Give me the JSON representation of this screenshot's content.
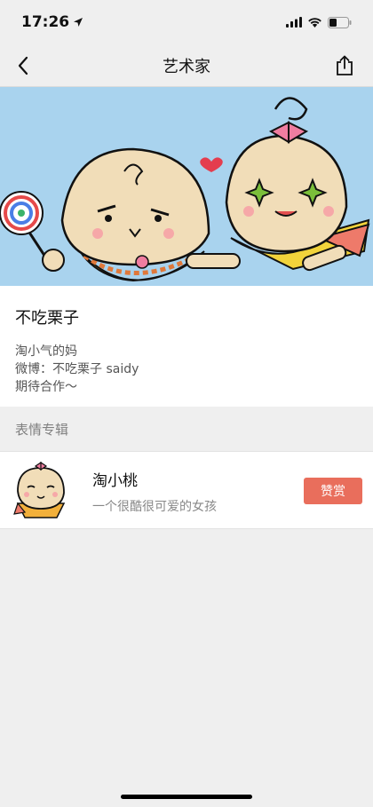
{
  "status_bar": {
    "time": "17:26"
  },
  "nav": {
    "title": "艺术家"
  },
  "profile": {
    "name": "不吃栗子",
    "bio": [
      "淘小气的妈",
      "微博：不吃栗子 saidy",
      "期待合作～"
    ]
  },
  "albums_section": {
    "header": "表情专辑",
    "items": [
      {
        "title": "淘小桃",
        "description": "一个很酷很可爱的女孩",
        "action_label": "赞赏"
      }
    ]
  },
  "colors": {
    "banner_bg": "#a9d3ee",
    "reward_button": "#e96e5c",
    "page_bg": "#efefef"
  }
}
